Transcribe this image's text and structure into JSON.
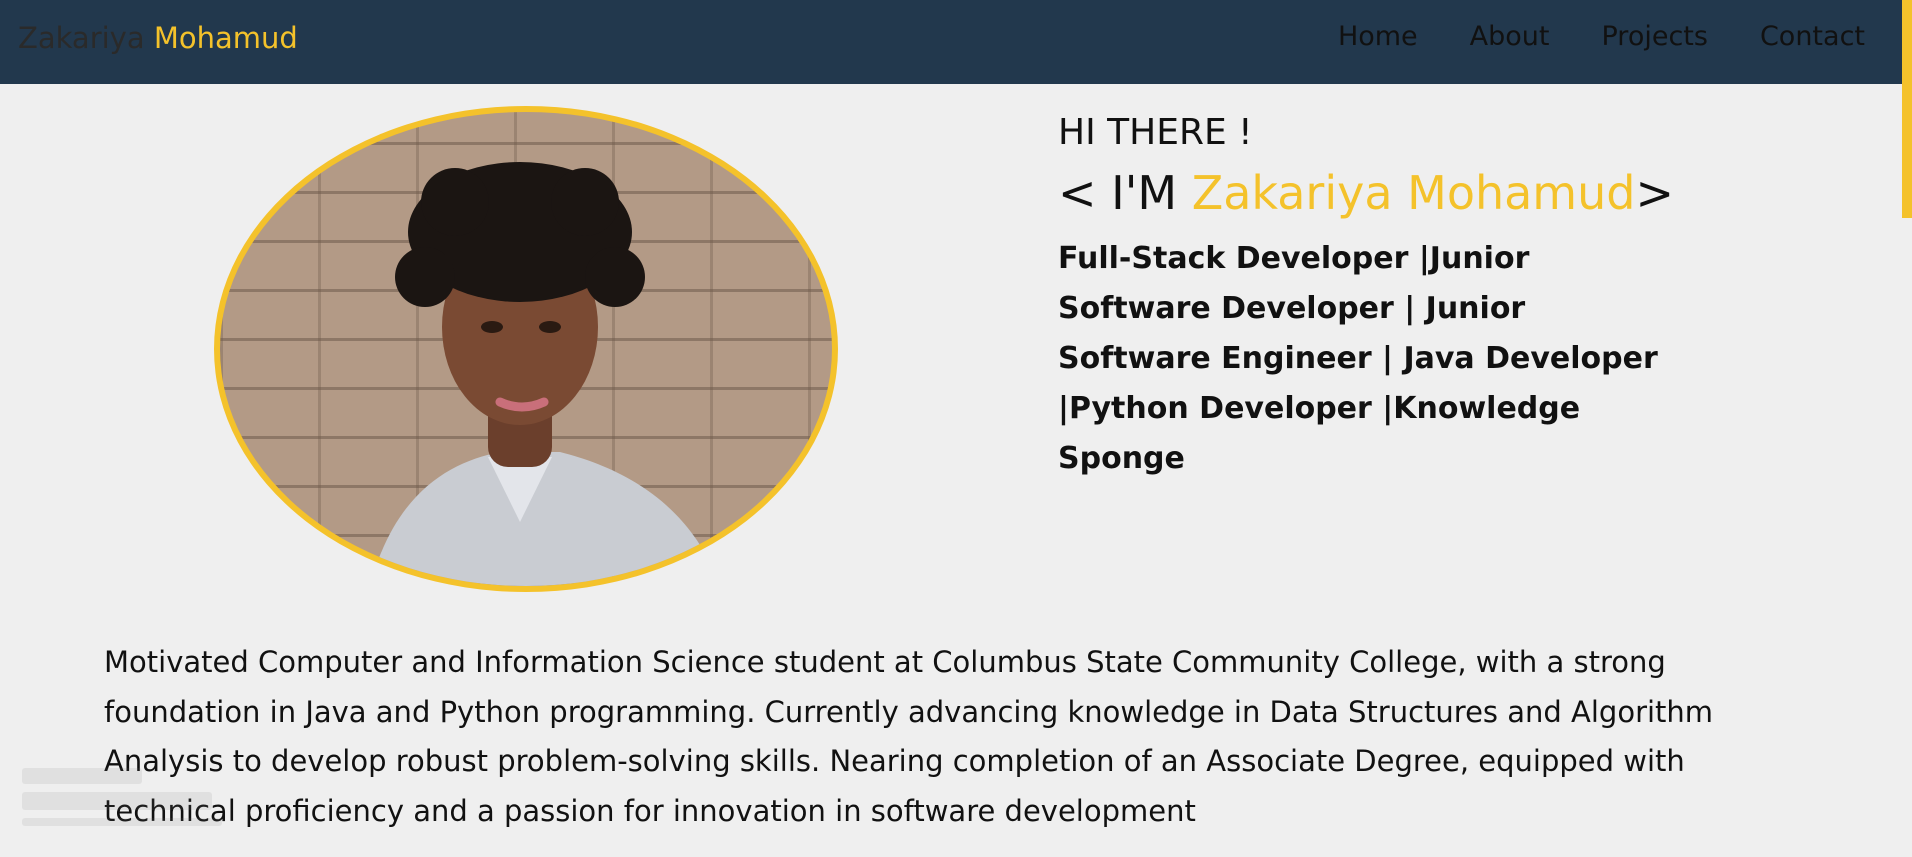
{
  "header": {
    "brand_first": "Zakariya",
    "brand_last": "Mohamud",
    "nav": [
      {
        "label": "Home"
      },
      {
        "label": "About"
      },
      {
        "label": "Projects"
      },
      {
        "label": "Contact"
      }
    ]
  },
  "hero": {
    "greeting": "HI THERE !",
    "name_prefix": "< I'M ",
    "name": "Zakariya Mohamud",
    "name_suffix": ">",
    "roles": "Full-Stack Developer |Junior Software Developer | Junior Software Engineer | Java Developer |Python Developer |Knowledge Sponge"
  },
  "about": {
    "bio": "Motivated Computer and Information Science student at Columbus State Community College, with a strong foundation in Java and Python programming. Currently advancing knowledge in Data Structures and Algorithm Analysis to develop robust problem-solving skills. Nearing completion of an Associate Degree, equipped with technical proficiency and a passion for innovation in software development"
  },
  "colors": {
    "navbar": "#22384d",
    "accent": "#f4c22b",
    "background": "#efefef"
  }
}
